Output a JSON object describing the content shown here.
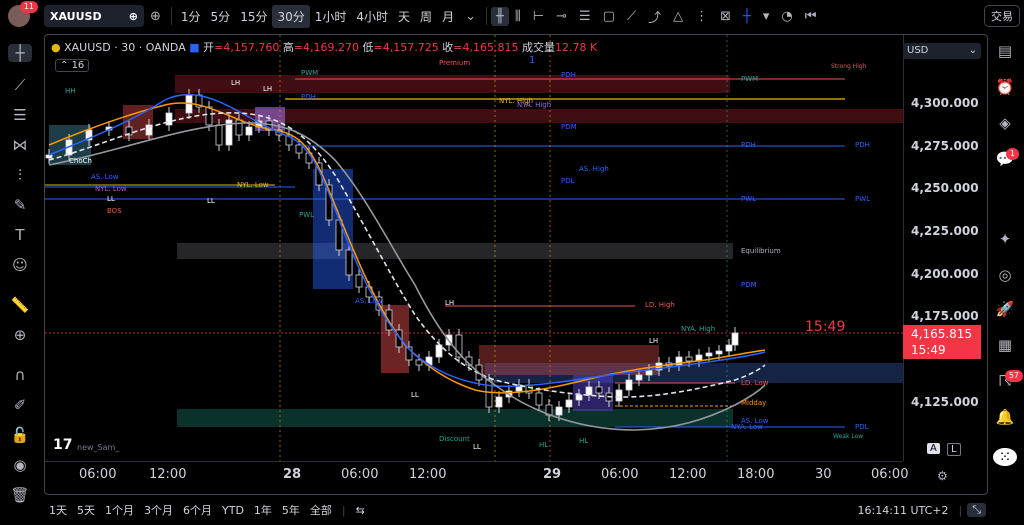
{
  "topbar": {
    "avatar_badge": "11",
    "symbol": "XAUUSD",
    "intervals": [
      "1分",
      "5分",
      "15分",
      "30分",
      "1小时",
      "4小时",
      "天",
      "周",
      "月"
    ],
    "active_interval": "30分",
    "trade_label": "交易"
  },
  "header": {
    "title": "XAUUSD · 30 · OANDA",
    "open_label": "开",
    "open": "=4,157.760",
    "high_label": "高",
    "high": "=4,169.270",
    "low_label": "低",
    "low": "=4,157.725",
    "close_label": "收",
    "close": "=4,165.815",
    "volume_label": "成交量",
    "volume": "12.78 K",
    "indicator_count": "16"
  },
  "price_axis": {
    "currency": "USD",
    "labels": [
      "4,300.000",
      "4,275.000",
      "4,250.000",
      "4,225.000",
      "4,200.000",
      "4,175.000",
      "4,125.000"
    ],
    "current_price": "4,165.815",
    "countdown": "15:49"
  },
  "time_axis": {
    "labels": [
      "06:00",
      "12:00",
      "28",
      "06:00",
      "12:00",
      "29",
      "06:00",
      "12:00",
      "18:00",
      "30",
      "06:00"
    ]
  },
  "chart_labels": {
    "premium": "Premium",
    "equilibrium": "Equilibrium",
    "discount": "Discount",
    "strong_high": "Strong High",
    "weak_low": "Weak Low",
    "pwm": "PWM",
    "pdh": "PDH",
    "pdm": "PDM",
    "pdl": "PDL",
    "pwl": "PWL",
    "nyl_high": "NYL. High",
    "nyl_low": "NYL. Low",
    "nya_high": "NYA. High",
    "nya_low": "NYA. Low",
    "as_high": "AS. High",
    "as_low": "AS. Low",
    "ld_high": "LD. High",
    "ld_low": "LD. Low",
    "midday": "Midday",
    "lh": "LH",
    "ll": "LL",
    "hl": "HL",
    "hh": "HH",
    "bos": "BOS",
    "choch": "ChoCh",
    "author": "new_Sam_",
    "number_one": "1"
  },
  "bottombar": {
    "ranges": [
      "1天",
      "5天",
      "1个月",
      "3个月",
      "6个月",
      "YTD",
      "1年",
      "5年",
      "全部"
    ],
    "clock": "16:14:11 UTC+2",
    "a_label": "A",
    "l_label": "L"
  },
  "right_toolbar": {
    "notification_badge": "1",
    "feed_badge": "57"
  },
  "colors": {
    "bull": "#26a69a",
    "bear": "#ef5350",
    "accent": "#2962ff",
    "price_tag": "#f23645"
  }
}
